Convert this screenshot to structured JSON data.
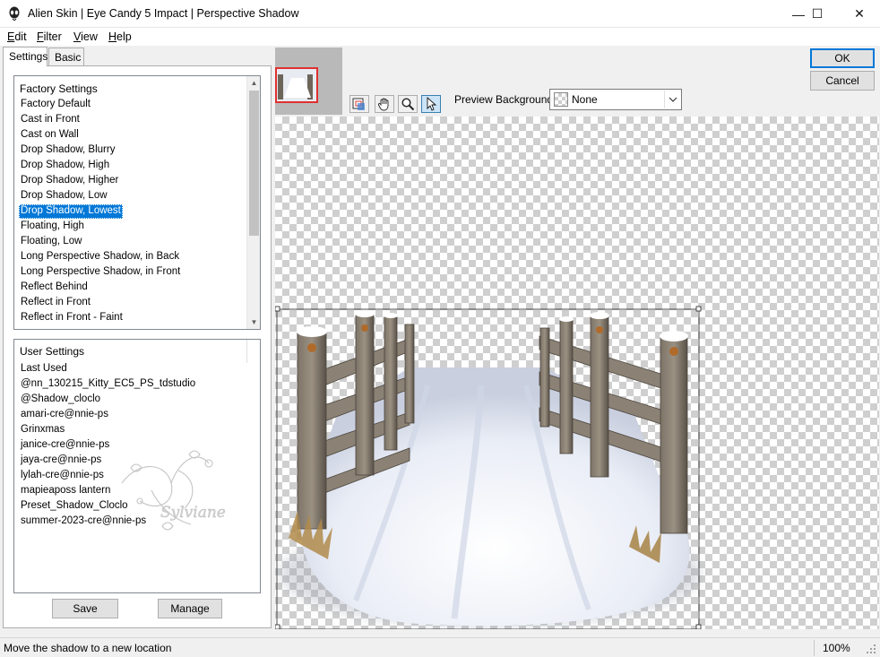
{
  "window": {
    "title": "Alien Skin | Eye Candy 5 Impact | Perspective Shadow",
    "minimize_glyph": "—",
    "maximize_glyph": "☐",
    "close_glyph": "✕"
  },
  "menu": {
    "items": [
      {
        "label": "Edit",
        "accel": "E"
      },
      {
        "label": "Filter",
        "accel": "F"
      },
      {
        "label": "View",
        "accel": "V"
      },
      {
        "label": "Help",
        "accel": "H"
      }
    ]
  },
  "tabs": [
    "Settings",
    "Basic"
  ],
  "factory_settings": {
    "header": "Factory Settings",
    "items": [
      "Factory Default",
      "Cast in Front",
      "Cast on Wall",
      "Drop Shadow, Blurry",
      "Drop Shadow, High",
      "Drop Shadow, Higher",
      "Drop Shadow, Low",
      "Drop Shadow, Lowest",
      "Floating, High",
      "Floating, Low",
      "Long Perspective Shadow, in Back",
      "Long Perspective Shadow, in Front",
      "Reflect Behind",
      "Reflect in Front",
      "Reflect in Front - Faint"
    ],
    "selected": "Drop Shadow, Lowest"
  },
  "user_settings": {
    "header": "User Settings",
    "items": [
      "Last Used",
      "@nn_130215_Kitty_EC5_PS_tdstudio",
      "@Shadow_cloclo",
      "amari-cre@nnie-ps",
      "Grinxmas",
      "janice-cre@nnie-ps",
      "jaya-cre@nnie-ps",
      "lylah-cre@nnie-ps",
      "mapieaposs lantern",
      "Preset_Shadow_Cloclo",
      "summer-2023-cre@nnie-ps"
    ],
    "watermark_text": "Sylviane"
  },
  "buttons": {
    "save": "Save",
    "manage": "Manage",
    "ok": "OK",
    "cancel": "Cancel"
  },
  "preview": {
    "background_label": "Preview Background:",
    "background_value": "None",
    "tools": [
      "navigator-icon",
      "hand-icon",
      "zoom-icon",
      "arrow-icon"
    ]
  },
  "status": {
    "message": "Move the shadow to a new location",
    "zoom": "100%"
  },
  "colors": {
    "selection": "#0078d7",
    "nav_rect": "#e03030",
    "snow": "#eef1f8",
    "wood": "#6e655a"
  }
}
